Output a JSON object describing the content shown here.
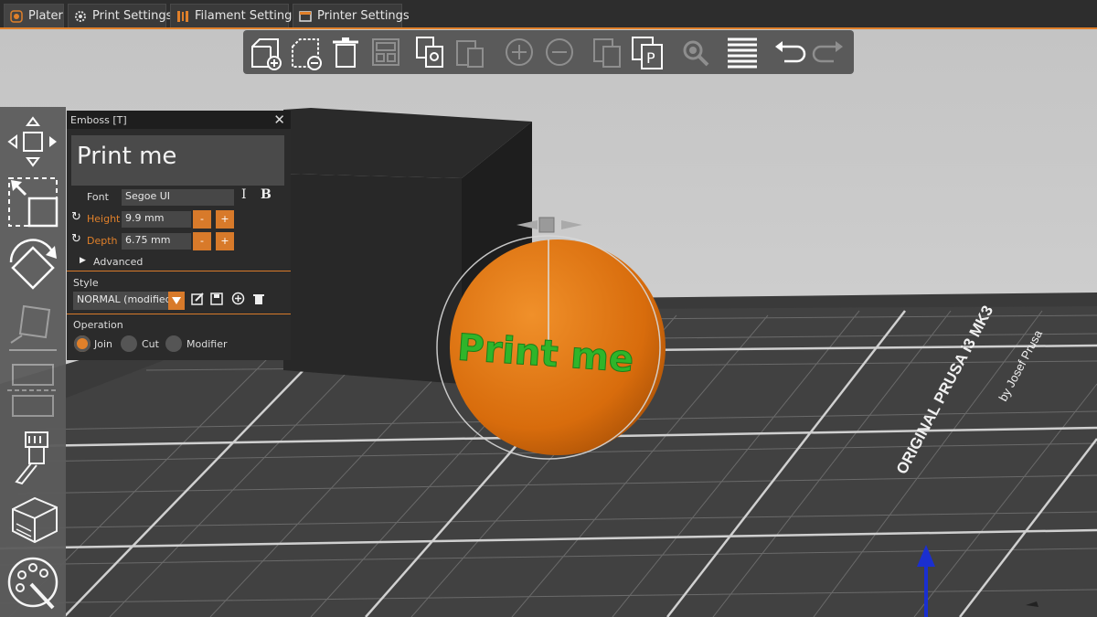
{
  "tabs": [
    {
      "label": "Plater",
      "active": true,
      "icon": "plater-icon"
    },
    {
      "label": "Print Settings",
      "active": false,
      "icon": "gear-icon"
    },
    {
      "label": "Filament Settings",
      "active": false,
      "icon": "filament-spool-icon"
    },
    {
      "label": "Printer Settings",
      "active": false,
      "icon": "printer-icon"
    }
  ],
  "toolbar_icons": [
    "add-object-icon",
    "delete-object-icon",
    "delete-all-icon",
    "arrange-icon",
    "copy-icon",
    "paste-icon",
    "add-instance-icon",
    "remove-instance-icon",
    "split-objects-icon",
    "split-parts-icon",
    "search-icon",
    "layers-editing-icon",
    "undo-icon",
    "redo-icon"
  ],
  "left_tools": [
    "move-icon",
    "scale-icon",
    "rotate-icon",
    "place-on-face-icon",
    "cut-icon",
    "paint-supports-icon",
    "seam-painting-icon",
    "mmu-painting-icon"
  ],
  "emboss": {
    "title": "Emboss [T]",
    "text": "Print me",
    "font_label": "Font",
    "font_value": "Segoe UI",
    "height_label": "Height",
    "height_value": "9.9 mm",
    "depth_label": "Depth",
    "depth_value": "6.75 mm",
    "minus": "-",
    "plus": "+",
    "advanced_label": "Advanced",
    "style_label": "Style",
    "style_value": "NORMAL (modified)",
    "operation_label": "Operation",
    "operations": [
      "Join",
      "Cut",
      "Modifier"
    ],
    "selected_operation": "Join"
  },
  "bed": {
    "brand_line1": "ORIGINAL PRUSA i3 MK3",
    "brand_line2": "by Josef Prusa"
  },
  "scene_text": "Print me",
  "colors": {
    "accent": "#e0802a",
    "object": "#e07a10",
    "text_mesh": "#2fb52a",
    "bed": "#3c3c3c"
  }
}
